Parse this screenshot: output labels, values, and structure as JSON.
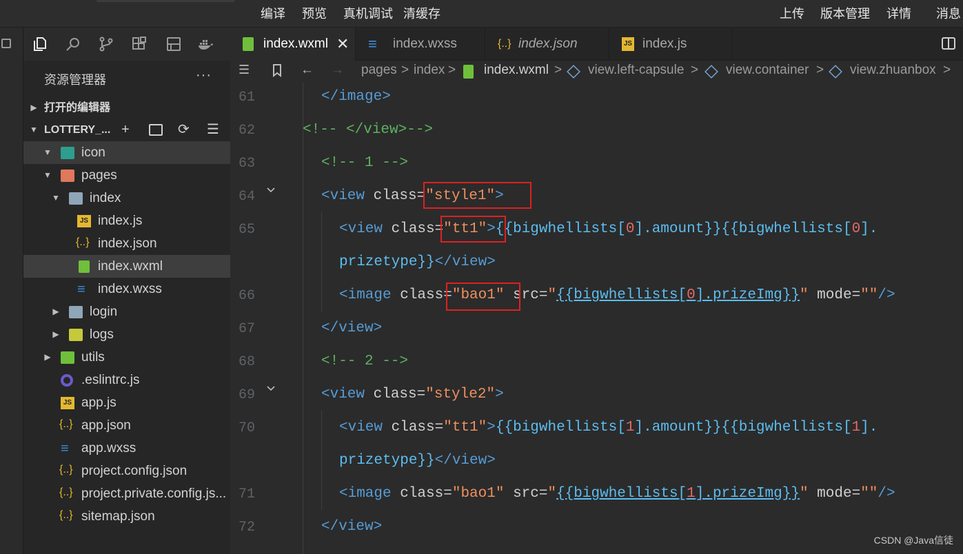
{
  "topbar": {
    "menu_left": [
      "编译",
      "预览",
      "真机调试",
      "清缓存"
    ],
    "menu_right": [
      "上传",
      "版本管理",
      "详情",
      "消息"
    ]
  },
  "activity_icons": [
    "files-icon",
    "search-icon",
    "source-control-icon",
    "extensions-icon",
    "outline-icon",
    "docker-icon"
  ],
  "explorer": {
    "title": "资源管理器",
    "more": "···",
    "open_editors": "打开的编辑器",
    "project": "LOTTERY_...",
    "tree": [
      {
        "label": "icon",
        "level": 1,
        "type": "folder-open",
        "selected": false
      },
      {
        "label": "pages",
        "level": 1,
        "type": "folder-open",
        "selected": false
      },
      {
        "label": "index",
        "level": 2,
        "type": "folder-open",
        "selected": false
      },
      {
        "label": "index.js",
        "level": 3,
        "type": "js",
        "selected": false
      },
      {
        "label": "index.json",
        "level": 3,
        "type": "json",
        "selected": false
      },
      {
        "label": "index.wxml",
        "level": 3,
        "type": "wxml",
        "selected": true
      },
      {
        "label": "index.wxss",
        "level": 3,
        "type": "wxss",
        "selected": false
      },
      {
        "label": "login",
        "level": 2,
        "type": "folder",
        "selected": false
      },
      {
        "label": "logs",
        "level": 2,
        "type": "folder",
        "selected": false
      },
      {
        "label": "utils",
        "level": 1,
        "type": "folder",
        "selected": false
      },
      {
        "label": ".eslintrc.js",
        "level": 1,
        "type": "eslint",
        "selected": false
      },
      {
        "label": "app.js",
        "level": 1,
        "type": "js",
        "selected": false
      },
      {
        "label": "app.json",
        "level": 1,
        "type": "json",
        "selected": false
      },
      {
        "label": "app.wxss",
        "level": 1,
        "type": "wxss",
        "selected": false
      },
      {
        "label": "project.config.json",
        "level": 1,
        "type": "json",
        "selected": false
      },
      {
        "label": "project.private.config.js...",
        "level": 1,
        "type": "json",
        "selected": false
      },
      {
        "label": "sitemap.json",
        "level": 1,
        "type": "json",
        "selected": false
      }
    ]
  },
  "tabs": [
    {
      "label": "index.wxml",
      "active": true,
      "close": "✕"
    },
    {
      "label": "index.wxss",
      "active": false
    },
    {
      "label": "index.json",
      "active": false
    },
    {
      "label": "index.js",
      "active": false
    }
  ],
  "breadcrumb": {
    "items": [
      "pages",
      "index",
      "index.wxml",
      "view.left-capsule",
      "view.container",
      "view.zhuanbox"
    ],
    "separator": ">"
  },
  "code": {
    "line_numbers": [
      "61",
      "62",
      "63",
      "64",
      "65",
      "",
      "66",
      "67",
      "68",
      "69",
      "70",
      "",
      "71",
      "72"
    ],
    "lines": {
      "l61": "</image>",
      "l62": "<!-- </view>-->",
      "l63": "<!-- 1 -->",
      "l64a": "<view",
      "l64b": " class=",
      "l64c": "\"style1\"",
      "l64d": ">",
      "l65a": "<view",
      "l65b": " class=",
      "l65c": "\"tt1\"",
      "l65d": ">",
      "l65e": "{{bigwhellists[",
      "l65f": "0",
      "l65g": "].amount}}{{bigwhellists[",
      "l65h": "0",
      "l65i": "].",
      "l65j": "prizetype}}",
      "l65k": "</view>",
      "l66a": "<image",
      "l66b": " class=",
      "l66c": "\"bao1\"",
      "l66d": " src=",
      "l66e": "\"",
      "l66f": "{{bigwhellists[",
      "l66g": "0",
      "l66h": "].prizeImg}}",
      "l66i": "\"",
      "l66j": " mode=",
      "l66k": "\"\"",
      "l66l": "/>",
      "l67": "</view>",
      "l68": "<!-- 2 -->",
      "l69a": "<view",
      "l69b": " class=",
      "l69c": "\"style2\"",
      "l69d": ">",
      "l70a": "<view",
      "l70b": " class=",
      "l70c": "\"tt1\"",
      "l70d": ">",
      "l70e": "{{bigwhellists[",
      "l70f": "1",
      "l70g": "].amount}}{{bigwhellists[",
      "l70h": "1",
      "l70i": "].",
      "l70j": "prizetype}}",
      "l70k": "</view>",
      "l71a": "<image",
      "l71b": " class=",
      "l71c": "\"bao1\"",
      "l71d": " src=",
      "l71e": "\"",
      "l71f": "{{bigwhellists[",
      "l71g": "1",
      "l71h": "].prizeImg}}",
      "l71i": "\"",
      "l71j": " mode=",
      "l71k": "\"\"",
      "l71l": "/>",
      "l72": "</view>"
    }
  },
  "watermark": "CSDN @Java信徒",
  "colors": {
    "tag": "#569cd6",
    "string": "#ef8f5f",
    "comment": "#5fb15f",
    "mustache": "#5cbdf0",
    "highlight_box": "#e02020"
  }
}
